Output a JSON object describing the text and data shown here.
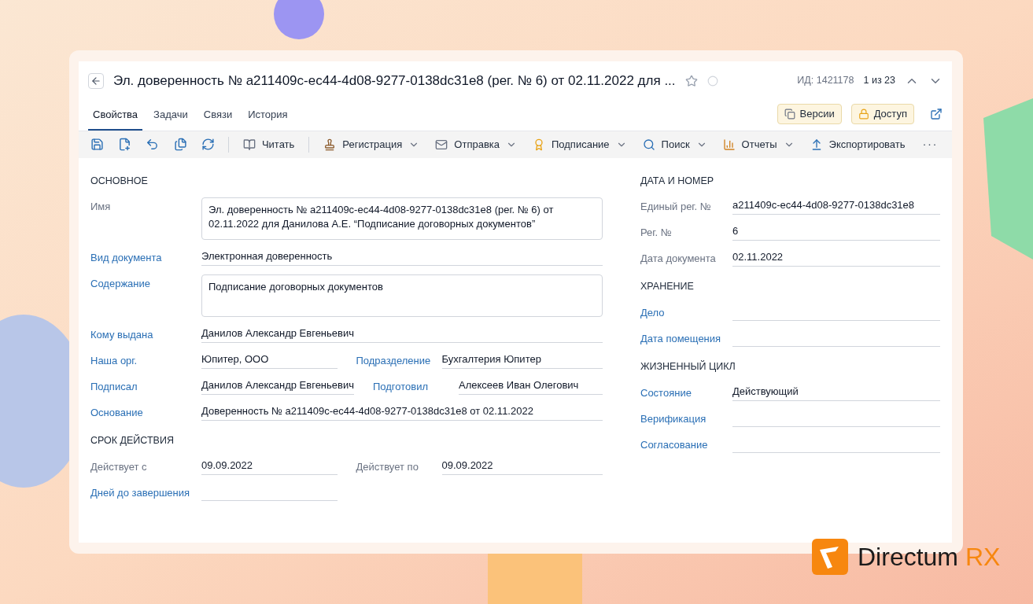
{
  "header": {
    "title": "Эл. доверенность № a211409c-ec44-4d08-9277-0138dc31e8 (рег. № 6) от 02.11.2022 для ...",
    "favorite": false,
    "id_text": "ИД: 1421178",
    "position": "1 из 23"
  },
  "tabs": [
    {
      "label": "Свойства",
      "selected": true
    },
    {
      "label": "Задачи",
      "selected": false
    },
    {
      "label": "Связи",
      "selected": false
    },
    {
      "label": "История",
      "selected": false
    }
  ],
  "header_buttons": [
    "Версии",
    "Доступ"
  ],
  "toolbar": [
    {
      "kind": "icon"
    },
    {
      "kind": "icon"
    },
    {
      "kind": "icon"
    },
    {
      "kind": "icon"
    },
    {
      "kind": "icon"
    },
    {
      "kind": "separator"
    },
    {
      "kind": "button",
      "label": "Читать"
    },
    {
      "kind": "separator"
    },
    {
      "kind": "menu",
      "label": "Регистрация"
    },
    {
      "kind": "menu",
      "label": "Отправка"
    },
    {
      "kind": "menu",
      "label": "Подписание"
    },
    {
      "kind": "menu",
      "label": "Поиск"
    },
    {
      "kind": "menu",
      "label": "Отчеты"
    },
    {
      "kind": "button",
      "label": "Экспортировать"
    },
    {
      "kind": "more",
      "label": "···"
    }
  ],
  "left_sections": [
    {
      "rows": [
        {
          "fields": [
            {
              "label": "Имя",
              "link": false,
              "multiline": true,
              "value": "Эл. доверенность № a211409c-ec44-4d08-9277-0138dc31e8 (рег. № 6) от 02.11.2022 для Данилова А.Е. “Подписание договорных документов”"
            }
          ]
        },
        {
          "fields": [
            {
              "label": "Вид документа",
              "link": true,
              "multiline": false,
              "value": "Электронная доверенность"
            }
          ]
        },
        {
          "fields": [
            {
              "label": "Содержание",
              "link": true,
              "multiline": true,
              "value": "Подписание договорных документов"
            }
          ]
        },
        {
          "fields": [
            {
              "label": "Кому выдана",
              "link": true,
              "multiline": false,
              "value": "Данилов Александр Евгеньевич"
            }
          ]
        },
        {
          "fields": [
            {
              "label": "Наша орг.",
              "link": true,
              "multiline": false,
              "value": "Юпитер, ООО"
            },
            {
              "label": "Подразделение",
              "link": true,
              "multiline": false,
              "value": "Бухгалтерия Юпитер"
            }
          ]
        },
        {
          "fields": [
            {
              "label": "Подписал",
              "link": true,
              "multiline": false,
              "value": "Данилов Александр Евгеньевич"
            },
            {
              "label": "Подготовил",
              "link": true,
              "multiline": false,
              "value": "Алексеев Иван Олегович"
            }
          ]
        },
        {
          "fields": [
            {
              "label": "Основание",
              "link": true,
              "multiline": false,
              "value": "Доверенность № a211409c-ec44-4d08-9277-0138dc31e8 от 02.11.2022"
            }
          ]
        }
      ],
      "title": "ОСНОВНОЕ"
    },
    {
      "title": "СРОК ДЕЙСТВИЯ",
      "rows": [
        {
          "fields": [
            {
              "label": "Действует с",
              "link": false,
              "multiline": false,
              "value": "09.09.2022"
            },
            {
              "label": "Действует по",
              "link": false,
              "multiline": false,
              "value": "09.09.2022"
            }
          ]
        },
        {
          "fields": [
            {
              "label": "Дней до завершения",
              "link": true,
              "multiline": false
            },
            {
              "kind": "empty"
            }
          ]
        }
      ]
    }
  ],
  "right_sections": [
    {
      "title": "ДАТА И НОМЕР",
      "rows": [
        {
          "fields": [
            {
              "label": "Единый рег. №",
              "link": false,
              "multiline": false,
              "value": "a211409c-ec44-4d08-9277-0138dc31e8"
            }
          ]
        },
        {
          "fields": [
            {
              "label": "Рег. №",
              "link": false,
              "multiline": false,
              "value": "6"
            }
          ]
        },
        {
          "fields": [
            {
              "label": "Дата документа",
              "link": false,
              "multiline": false,
              "value": "02.11.2022"
            }
          ]
        }
      ]
    },
    {
      "title": "ХРАНЕНИЕ",
      "rows": [
        {
          "fields": [
            {
              "label": "Дело",
              "link": true,
              "multiline": false
            }
          ]
        },
        {
          "fields": [
            {
              "label": "Дата помещения",
              "link": true,
              "multiline": false
            }
          ]
        }
      ]
    },
    {
      "title": "ЖИЗНЕННЫЙ ЦИКЛ",
      "rows": [
        {
          "fields": [
            {
              "label": "Состояние",
              "link": true,
              "multiline": false,
              "value": "Действующий"
            }
          ]
        },
        {
          "fields": [
            {
              "label": "Верификация",
              "link": true,
              "multiline": false
            }
          ]
        },
        {
          "fields": [
            {
              "label": "Согласование",
              "link": true,
              "multiline": false
            }
          ]
        }
      ]
    }
  ],
  "brand": {
    "name": "Directum",
    "suffix": "RX"
  }
}
